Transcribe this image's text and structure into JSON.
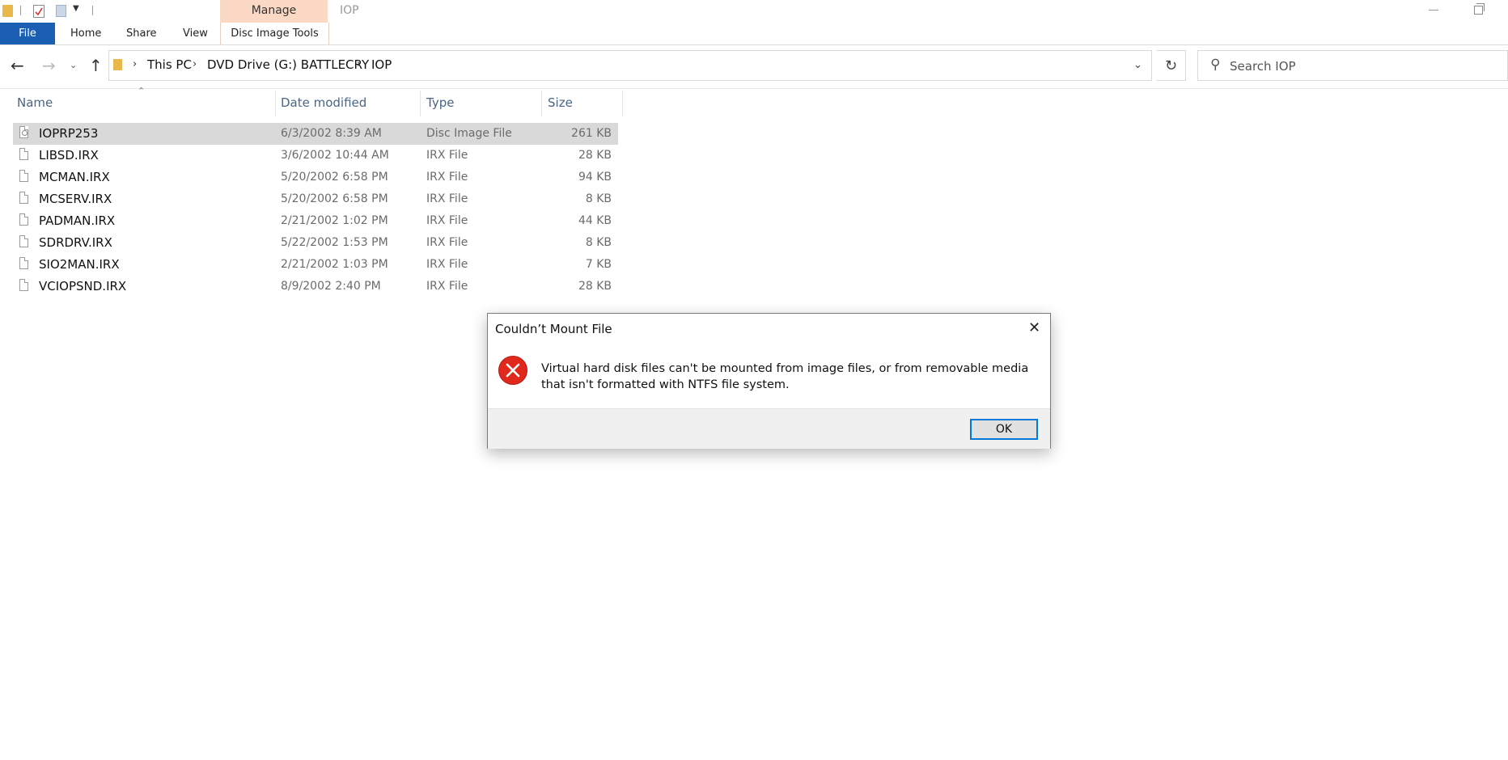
{
  "window": {
    "title": "IOP",
    "contextual_tab_group": "Manage",
    "contextual_tab": "Disc Image Tools"
  },
  "ribbon": {
    "tabs": [
      "File",
      "Home",
      "Share",
      "View"
    ]
  },
  "address": {
    "crumbs": [
      "This PC",
      "DVD Drive (G:) BATTLECRY",
      "IOP"
    ]
  },
  "search": {
    "placeholder": "Search IOP"
  },
  "columns": {
    "name": "Name",
    "date": "Date modified",
    "type": "Type",
    "size": "Size"
  },
  "files": [
    {
      "name": "IOPRP253",
      "date": "6/3/2002 8:39 AM",
      "type": "Disc Image File",
      "size": "261 KB",
      "selected": true
    },
    {
      "name": "LIBSD.IRX",
      "date": "3/6/2002 10:44 AM",
      "type": "IRX File",
      "size": "28 KB"
    },
    {
      "name": "MCMAN.IRX",
      "date": "5/20/2002 6:58 PM",
      "type": "IRX File",
      "size": "94 KB"
    },
    {
      "name": "MCSERV.IRX",
      "date": "5/20/2002 6:58 PM",
      "type": "IRX File",
      "size": "8 KB"
    },
    {
      "name": "PADMAN.IRX",
      "date": "2/21/2002 1:02 PM",
      "type": "IRX File",
      "size": "44 KB"
    },
    {
      "name": "SDRDRV.IRX",
      "date": "5/22/2002 1:53 PM",
      "type": "IRX File",
      "size": "8 KB"
    },
    {
      "name": "SIO2MAN.IRX",
      "date": "2/21/2002 1:03 PM",
      "type": "IRX File",
      "size": "7 KB"
    },
    {
      "name": "VCIOPSND.IRX",
      "date": "8/9/2002 2:40 PM",
      "type": "IRX File",
      "size": "28 KB"
    }
  ],
  "dialog": {
    "title": "Couldn’t Mount File",
    "message": "Virtual hard disk files can't be mounted from image files, or from removable media that isn't formatted with NTFS file system.",
    "ok_label": "OK",
    "icon": "error-icon"
  }
}
